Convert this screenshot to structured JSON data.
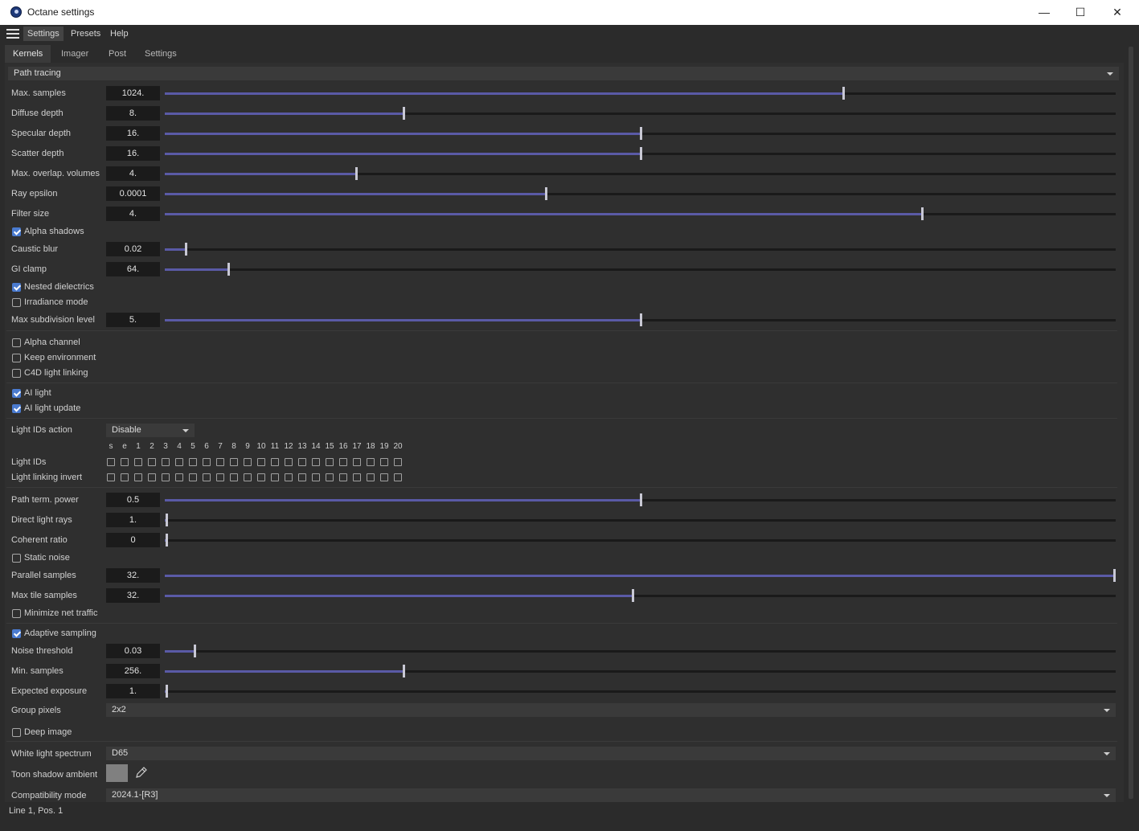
{
  "window": {
    "title": "Octane settings",
    "minimize": "—",
    "maximize": "☐",
    "close": "✕"
  },
  "menu": {
    "items": [
      "Settings",
      "Presets",
      "Help"
    ]
  },
  "tabs": [
    "Kernels",
    "Imager",
    "Post",
    "Settings"
  ],
  "kernel_select": {
    "value": "Path tracing"
  },
  "sliders": [
    {
      "label": "Max. samples",
      "value": "1024.",
      "fraction": 0.714
    },
    {
      "label": "Diffuse depth",
      "value": "8.",
      "fraction": 0.25
    },
    {
      "label": "Specular depth",
      "value": "16.",
      "fraction": 0.5
    },
    {
      "label": "Scatter depth",
      "value": "16.",
      "fraction": 0.5
    },
    {
      "label": "Max. overlap. volumes",
      "value": "4.",
      "fraction": 0.2
    },
    {
      "label": "Ray epsilon",
      "value": "0.0001",
      "fraction": 0.4
    },
    {
      "label": "Filter size",
      "value": "4.",
      "fraction": 0.797
    },
    {
      "label": "Caustic blur",
      "value": "0.02",
      "fraction": 0.02
    },
    {
      "label": "GI clamp",
      "value": "64.",
      "fraction": 0.065
    },
    {
      "label": "Max subdivision level",
      "value": "5.",
      "fraction": 0.5
    },
    {
      "label": "Path term. power",
      "value": "0.5",
      "fraction": 0.5
    },
    {
      "label": "Direct light rays",
      "value": "1.",
      "fraction": 0.0
    },
    {
      "label": "Coherent ratio",
      "value": "0",
      "fraction": 0.0
    },
    {
      "label": "Parallel samples",
      "value": "32.",
      "fraction": 1.0
    },
    {
      "label": "Max tile samples",
      "value": "32.",
      "fraction": 0.492
    },
    {
      "label": "Noise threshold",
      "value": "0.03",
      "fraction": 0.03
    },
    {
      "label": "Min. samples",
      "value": "256.",
      "fraction": 0.25
    },
    {
      "label": "Expected exposure",
      "value": "1.",
      "fraction": 0.0
    }
  ],
  "checkboxes": [
    {
      "label": "Alpha shadows",
      "checked": true
    },
    {
      "label": "Nested dielectrics",
      "checked": true
    },
    {
      "label": "Irradiance mode",
      "checked": false
    },
    {
      "label": "Alpha channel",
      "checked": false
    },
    {
      "label": "Keep environment",
      "checked": false
    },
    {
      "label": "C4D light linking",
      "checked": false
    },
    {
      "label": "AI light",
      "checked": true
    },
    {
      "label": "AI light update",
      "checked": true
    },
    {
      "label": "Static noise",
      "checked": false
    },
    {
      "label": "Minimize net traffic",
      "checked": false
    },
    {
      "label": "Adaptive sampling",
      "checked": true
    },
    {
      "label": "Deep image",
      "checked": false
    }
  ],
  "light_ids": {
    "action_label": "Light IDs action",
    "action_value": "Disable",
    "headers": [
      "s",
      "e",
      "1",
      "2",
      "3",
      "4",
      "5",
      "6",
      "7",
      "8",
      "9",
      "10",
      "11",
      "12",
      "13",
      "14",
      "15",
      "16",
      "17",
      "18",
      "19",
      "20"
    ],
    "row_ids_label": "Light IDs",
    "row_invert_label": "Light linking invert"
  },
  "group_pixels": {
    "label": "Group pixels",
    "value": "2x2"
  },
  "white_light": {
    "label": "White light spectrum",
    "value": "D65"
  },
  "toon_shadow": {
    "label": "Toon shadow ambient",
    "color": "#808080"
  },
  "compat": {
    "label": "Compatibility mode",
    "value": "2024.1-[R3]"
  },
  "status": {
    "text": "Line 1, Pos. 1"
  },
  "colors": {
    "slider_fill": "#5a5aa6",
    "checkbox_on": "#4a7bd0"
  }
}
